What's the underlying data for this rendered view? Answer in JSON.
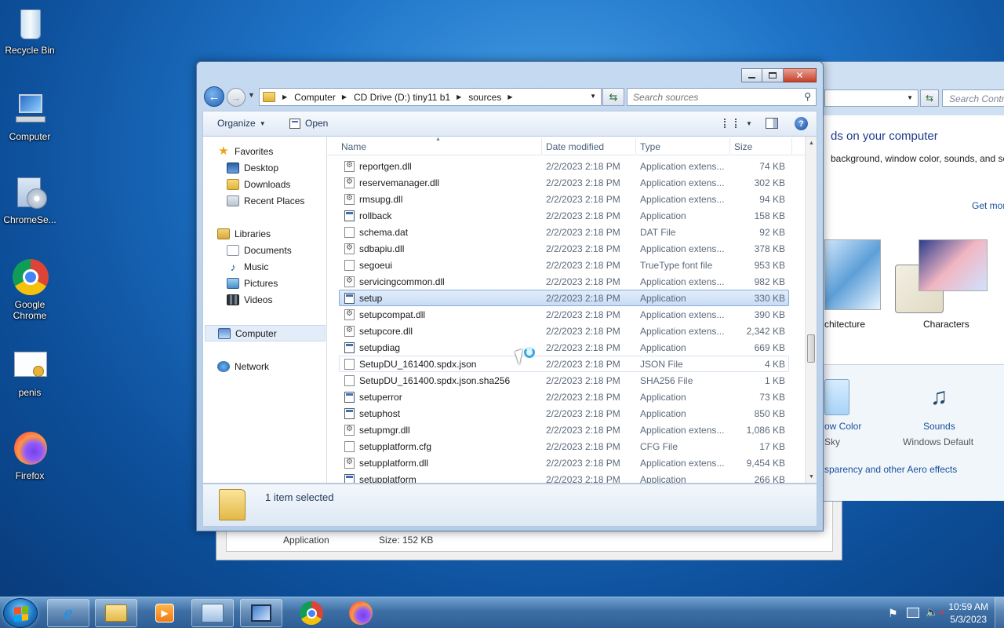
{
  "desktop": {
    "icons": [
      {
        "label": "Recycle Bin",
        "icon": "recycle-bin-icon"
      },
      {
        "label": "Computer",
        "icon": "computer-icon"
      },
      {
        "label": "ChromeSe...",
        "icon": "chrome-setup-icon"
      },
      {
        "label": "Google Chrome",
        "icon": "chrome-icon"
      },
      {
        "label": "penis",
        "icon": "certificate-icon"
      },
      {
        "label": "Firefox",
        "icon": "firefox-icon"
      }
    ]
  },
  "background_window": {
    "search_placeholder": "Search Control Panel",
    "heading": "ds on your computer",
    "subheading": "background, window color, sounds, and scr",
    "get_more": "Get mor",
    "themes": [
      {
        "label": "chitecture"
      },
      {
        "label": "Characters"
      }
    ],
    "bottom_items": [
      {
        "label": "ow Color",
        "sub": "Sky"
      },
      {
        "label": "Sounds",
        "sub": "Windows Default"
      }
    ],
    "aero_link": "sparency and other Aero effects"
  },
  "explorer": {
    "breadcrumbs": [
      "Computer",
      "CD Drive (D:) tiny11 b1",
      "sources"
    ],
    "search_placeholder": "Search sources",
    "toolbar": {
      "organize": "Organize",
      "open": "Open"
    },
    "nav": {
      "favorites": "Favorites",
      "favorites_items": [
        "Desktop",
        "Downloads",
        "Recent Places"
      ],
      "libraries": "Libraries",
      "libraries_items": [
        "Documents",
        "Music",
        "Pictures",
        "Videos"
      ],
      "computer": "Computer",
      "network": "Network"
    },
    "columns": {
      "name": "Name",
      "date": "Date modified",
      "type": "Type",
      "size": "Size"
    },
    "files": [
      {
        "name": "reportgen.dll",
        "date": "2/2/2023 2:18 PM",
        "type": "Application extens...",
        "size": "74 KB",
        "kind": "dll"
      },
      {
        "name": "reservemanager.dll",
        "date": "2/2/2023 2:18 PM",
        "type": "Application extens...",
        "size": "302 KB",
        "kind": "dll"
      },
      {
        "name": "rmsupg.dll",
        "date": "2/2/2023 2:18 PM",
        "type": "Application extens...",
        "size": "94 KB",
        "kind": "dll"
      },
      {
        "name": "rollback",
        "date": "2/2/2023 2:18 PM",
        "type": "Application",
        "size": "158 KB",
        "kind": "app"
      },
      {
        "name": "schema.dat",
        "date": "2/2/2023 2:18 PM",
        "type": "DAT File",
        "size": "92 KB",
        "kind": "file"
      },
      {
        "name": "sdbapiu.dll",
        "date": "2/2/2023 2:18 PM",
        "type": "Application extens...",
        "size": "378 KB",
        "kind": "dll"
      },
      {
        "name": "segoeui",
        "date": "2/2/2023 2:18 PM",
        "type": "TrueType font file",
        "size": "953 KB",
        "kind": "file"
      },
      {
        "name": "servicingcommon.dll",
        "date": "2/2/2023 2:18 PM",
        "type": "Application extens...",
        "size": "982 KB",
        "kind": "dll"
      },
      {
        "name": "setup",
        "date": "2/2/2023 2:18 PM",
        "type": "Application",
        "size": "330 KB",
        "kind": "app",
        "selected": true
      },
      {
        "name": "setupcompat.dll",
        "date": "2/2/2023 2:18 PM",
        "type": "Application extens...",
        "size": "390 KB",
        "kind": "dll"
      },
      {
        "name": "setupcore.dll",
        "date": "2/2/2023 2:18 PM",
        "type": "Application extens...",
        "size": "2,342 KB",
        "kind": "dll"
      },
      {
        "name": "setupdiag",
        "date": "2/2/2023 2:18 PM",
        "type": "Application",
        "size": "669 KB",
        "kind": "app"
      },
      {
        "name": "SetupDU_161400.spdx.json",
        "date": "2/2/2023 2:18 PM",
        "type": "JSON File",
        "size": "4 KB",
        "kind": "file",
        "hover": true
      },
      {
        "name": "SetupDU_161400.spdx.json.sha256",
        "date": "2/2/2023 2:18 PM",
        "type": "SHA256 File",
        "size": "1 KB",
        "kind": "file"
      },
      {
        "name": "setuperror",
        "date": "2/2/2023 2:18 PM",
        "type": "Application",
        "size": "73 KB",
        "kind": "app"
      },
      {
        "name": "setuphost",
        "date": "2/2/2023 2:18 PM",
        "type": "Application",
        "size": "850 KB",
        "kind": "app"
      },
      {
        "name": "setupmgr.dll",
        "date": "2/2/2023 2:18 PM",
        "type": "Application extens...",
        "size": "1,086 KB",
        "kind": "dll"
      },
      {
        "name": "setupplatform.cfg",
        "date": "2/2/2023 2:18 PM",
        "type": "CFG File",
        "size": "17 KB",
        "kind": "file"
      },
      {
        "name": "setupplatform.dll",
        "date": "2/2/2023 2:18 PM",
        "type": "Application extens...",
        "size": "9,454 KB",
        "kind": "dll"
      },
      {
        "name": "setupplatform",
        "date": "2/2/2023 2:18 PM",
        "type": "Application",
        "size": "266 KB",
        "kind": "app"
      }
    ],
    "status": "1 item selected"
  },
  "properties": {
    "type": "Application",
    "size": "Size: 152 KB"
  },
  "taskbar": {
    "time": "10:59 AM",
    "date": "5/3/2023"
  }
}
